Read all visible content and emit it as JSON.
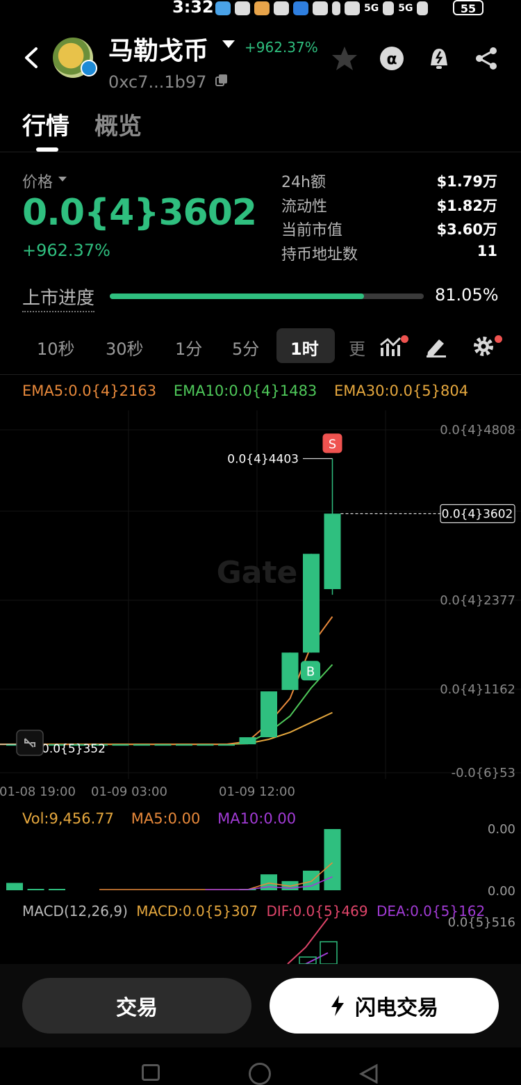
{
  "status_bar": {
    "time": "3:32",
    "signal_1": "5G",
    "signal_2": "5G",
    "battery": "55"
  },
  "header": {
    "token_name": "马勒戈币",
    "change": "+962.37%",
    "address": "0xc7...1b97"
  },
  "tabs": [
    {
      "label": "行情",
      "active": true
    },
    {
      "label": "概览",
      "active": false
    }
  ],
  "price_block": {
    "label": "价格",
    "price": "0.0{4}3602",
    "change": "+962.37%"
  },
  "stats": [
    {
      "label": "24h额",
      "value": "$1.79万"
    },
    {
      "label": "流动性",
      "value": "$1.82万"
    },
    {
      "label": "当前市值",
      "value": "$3.60万"
    },
    {
      "label": "持币地址数",
      "value": "11"
    }
  ],
  "progress": {
    "label": "上市进度",
    "value": "81.05%",
    "fraction": 0.8105
  },
  "timeframes": [
    "10秒",
    "30秒",
    "1分",
    "5分",
    "1时",
    "更"
  ],
  "active_timeframe": "1时",
  "colors": {
    "up": "#2fbf7f",
    "down": "#ef5350",
    "ema5": "#e8893b",
    "ema10": "#4fc95a",
    "ema30": "#e6a83e",
    "ma10": "#a23bd6"
  },
  "indicators": {
    "ema5": "EMA5:0.0{4}2163",
    "ema10": "EMA10:0.0{4}1483",
    "ema30": "EMA30:0.0{5}804"
  },
  "chart_data": {
    "type": "candlestick",
    "watermark": "Gate",
    "y_ticks": [
      "0.0{4}4808",
      "0.0{4}2377",
      "0.0{4}1162",
      "-0.0{6}53"
    ],
    "x_ticks": [
      "01-08 19:00",
      "01-09 03:00",
      "01-09 12:00"
    ],
    "high_label": "0.0{4}4403",
    "low_label": "0.0{5}352",
    "current_label": "0.0{4}3602",
    "sell_marker": "S",
    "buy_marker": "B",
    "candles": [
      {
        "open": 3.5e-06,
        "close": 3.5e-06,
        "high": 3.5e-06,
        "low": 3.5e-06
      },
      {
        "open": 3.5e-06,
        "close": 3.5e-06,
        "high": 3.5e-06,
        "low": 3.5e-06
      },
      {
        "open": 3.5e-06,
        "close": 3.5e-06,
        "high": 3.5e-06,
        "low": 3.5e-06
      },
      {
        "open": 3.5e-06,
        "close": 3.5e-06,
        "high": 3.5e-06,
        "low": 3.5e-06
      },
      {
        "open": 3.5e-06,
        "close": 3.5e-06,
        "high": 3.5e-06,
        "low": 3.5e-06
      },
      {
        "open": 3.5e-06,
        "close": 3.5e-06,
        "high": 3.5e-06,
        "low": 3.5e-06
      },
      {
        "open": 3.5e-06,
        "close": 3.5e-06,
        "high": 3.5e-06,
        "low": 3.5e-06
      },
      {
        "open": 3.5e-06,
        "close": 3.5e-06,
        "high": 3.5e-06,
        "low": 3.5e-06
      },
      {
        "open": 3.5e-06,
        "close": 3.5e-06,
        "high": 3.5e-06,
        "low": 3.5e-06
      },
      {
        "open": 3.5e-06,
        "close": 3.5e-06,
        "high": 3.5e-06,
        "low": 3.5e-06
      },
      {
        "open": 3.5e-06,
        "close": 3.5e-06,
        "high": 3.5e-06,
        "low": 3.5e-06
      },
      {
        "open": 3.5e-06,
        "close": 4.5e-06,
        "high": 4.5e-06,
        "low": 3.5e-06
      },
      {
        "open": 4.5e-06,
        "close": 1.1e-05,
        "high": 1.1e-05,
        "low": 4.5e-06
      },
      {
        "open": 1.12e-05,
        "close": 1.65e-05,
        "high": 1.65e-05,
        "low": 1.12e-05
      },
      {
        "open": 1.65e-05,
        "close": 3.05e-05,
        "high": 3.05e-05,
        "low": 1.65e-05
      },
      {
        "open": 2.55e-05,
        "close": 3.62e-05,
        "high": 4.4e-05,
        "low": 2.47e-05
      }
    ],
    "ema5_series": [
      3.5e-06,
      3.5e-06,
      3.5e-06,
      3.5e-06,
      3.5e-06,
      3.5e-06,
      3.5e-06,
      3.5e-06,
      3.5e-06,
      3.5e-06,
      3.5e-06,
      3.9e-06,
      6.5e-06,
      1e-05,
      1.75e-05,
      2.16e-05
    ],
    "ema10_series": [
      3.5e-06,
      3.5e-06,
      3.5e-06,
      3.5e-06,
      3.5e-06,
      3.5e-06,
      3.5e-06,
      3.5e-06,
      3.5e-06,
      3.5e-06,
      3.5e-06,
      3.7e-06,
      5.2e-06,
      7.5e-06,
      1.15e-05,
      1.48e-05
    ],
    "ema30_series": [
      3.5e-06,
      3.5e-06,
      3.5e-06,
      3.5e-06,
      3.5e-06,
      3.5e-06,
      3.5e-06,
      3.5e-06,
      3.5e-06,
      3.5e-06,
      3.5e-06,
      3.6e-06,
      4.2e-06,
      5.2e-06,
      6.6e-06,
      8e-06
    ]
  },
  "volume": {
    "vol": "Vol:9,456.77",
    "ma5": "MA5:0.00",
    "ma10": "MA10:0.00",
    "y_top": "0.00",
    "y_bottom": "0.00",
    "bars": [
      0.12,
      0.01,
      0.01,
      0.0,
      0.0,
      0.0,
      0.0,
      0.0,
      0.0,
      0.0,
      0.0,
      0.02,
      0.26,
      0.15,
      0.32,
      1.0
    ]
  },
  "macd": {
    "title": "MACD(12,26,9)",
    "macd": "MACD:0.0{5}307",
    "dif": "DIF:0.0{5}469",
    "dea": "DEA:0.0{5}162",
    "y_top": "0.0{5}516"
  },
  "buttons": {
    "trade": "交易",
    "flash_trade": "闪电交易"
  }
}
